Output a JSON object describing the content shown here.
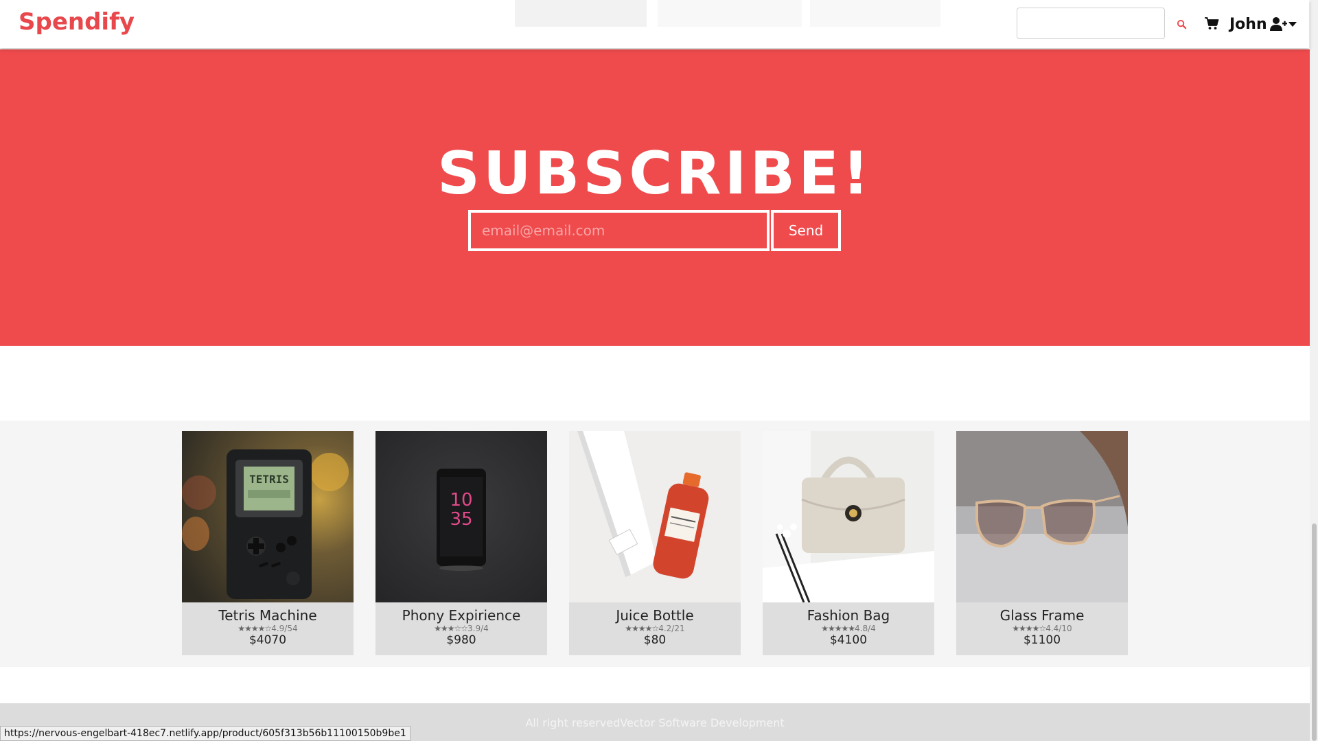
{
  "navbar": {
    "brand": "Spendify",
    "search_placeholder": "",
    "user_name": "John",
    "icons": [
      "search-icon",
      "cart-icon",
      "user-icon",
      "caret-down-icon"
    ],
    "brand_color": "#e8474b"
  },
  "subscribe": {
    "title": "SUBSCRIBE!",
    "email_placeholder": "email@email.com",
    "send_label": "Send",
    "background": "#ef4b4d"
  },
  "products": [
    {
      "name": "Tetris Machine",
      "stars": "★★★★☆",
      "rating": "4.9/54",
      "price": "$4070"
    },
    {
      "name": "Phony Expirience",
      "stars": "★★★☆☆",
      "rating": "3.9/4",
      "price": "$980"
    },
    {
      "name": "Juice Bottle",
      "stars": "★★★★☆",
      "rating": "4.2/21",
      "price": "$80"
    },
    {
      "name": "Fashion Bag",
      "stars": "★★★★★",
      "rating": "4.8/4",
      "price": "$4100"
    },
    {
      "name": "Glass Frame",
      "stars": "★★★★☆",
      "rating": "4.4/10",
      "price": "$1100"
    }
  ],
  "footer": {
    "text": "All right reservedVector Software Development"
  },
  "status_bar": {
    "url": "https://nervous-engelbart-418ec7.netlify.app/product/605f313b56b11100150b9be1"
  }
}
